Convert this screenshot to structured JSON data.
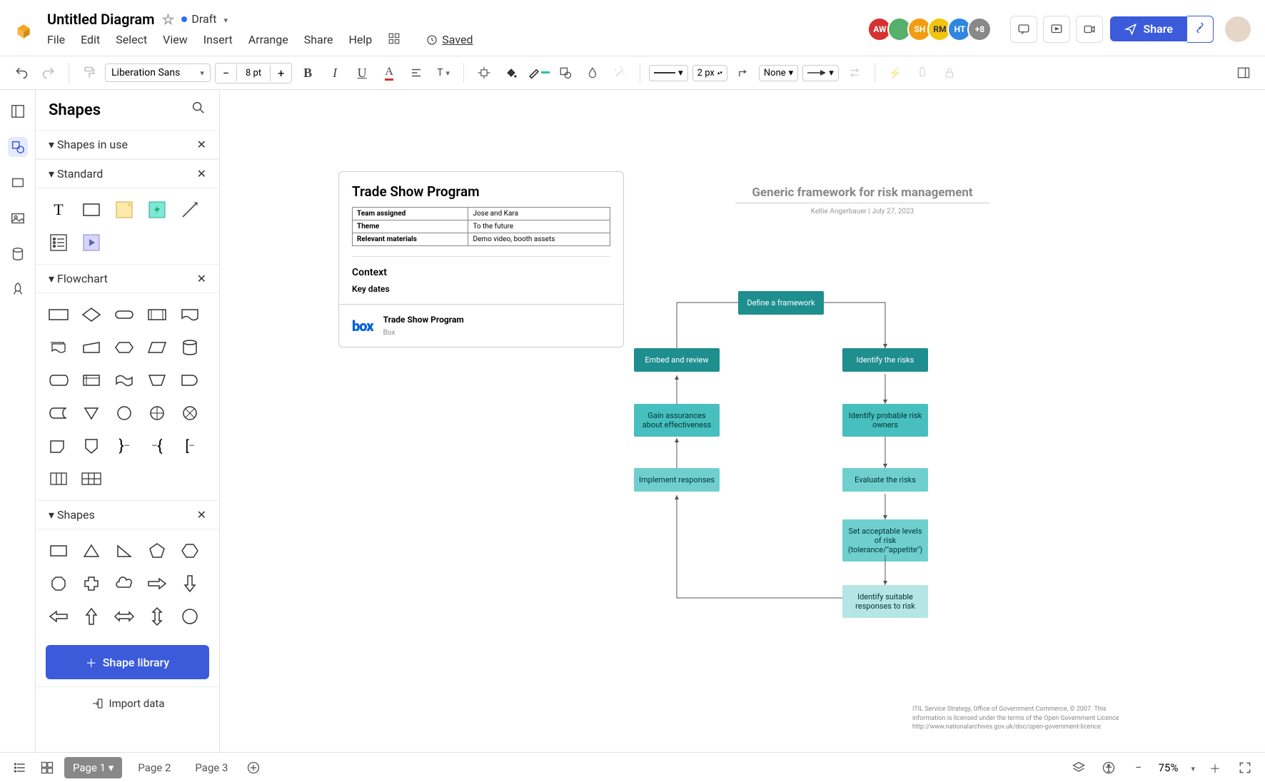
{
  "header": {
    "title": "Untitled Diagram",
    "status": "Draft",
    "saved": "Saved",
    "share": "Share",
    "avatars": [
      {
        "label": "AW",
        "color": "#d63031"
      },
      {
        "label": "",
        "color": "#55b06b"
      },
      {
        "label": "SH",
        "color": "#f39c12"
      },
      {
        "label": "RM",
        "color": "#f1c40f"
      },
      {
        "label": "HT",
        "color": "#2e86de"
      },
      {
        "label": "+8",
        "color": "#888"
      }
    ],
    "menu": [
      "File",
      "Edit",
      "Select",
      "View",
      "Insert",
      "Arrange",
      "Share",
      "Help"
    ]
  },
  "toolbar": {
    "font": "Liberation Sans",
    "font_size": "8 pt",
    "stroke_width": "2 px",
    "arrow_style": "None"
  },
  "sidebar": {
    "title": "Shapes",
    "sections": [
      "Shapes in use",
      "Standard",
      "Flowchart",
      "Shapes"
    ],
    "shape_library": "Shape library",
    "import": "Import data"
  },
  "canvas": {
    "card": {
      "title": "Trade Show Program",
      "rows": [
        {
          "k": "Team assigned",
          "v": "Jose and Kara"
        },
        {
          "k": "Theme",
          "v": "To the future"
        },
        {
          "k": "Relevant materials",
          "v": "Demo video, booth assets"
        }
      ],
      "context": "Context",
      "key_dates": "Key dates",
      "file_title": "Trade Show Program",
      "file_source": "Box"
    },
    "framework": {
      "title": "Generic framework for risk management",
      "byline": "Kellie Angerbauer  |  July 27, 2023",
      "boxes": {
        "define": "Define a framework",
        "embed": "Embed and review",
        "identify": "Identify the risks",
        "gain": "Gain assurances about effectiveness",
        "owners": "Identify probable risk owners",
        "implement": "Implement responses",
        "evaluate": "Evaluate the risks",
        "levels": "Set acceptable levels of risk (tolerance/\"appetite\")",
        "responses": "Identify suitable responses to risk"
      },
      "citation": "ITIL Service Strategy, Office of Government Commerce, © 2007. This information is licensed under the terms of the Open Government Licence http://www.nationalarchives.gov.uk/doc/open-government-licence"
    }
  },
  "footer": {
    "pages": [
      "Page 1",
      "Page 2",
      "Page 3"
    ],
    "zoom": "75%"
  }
}
